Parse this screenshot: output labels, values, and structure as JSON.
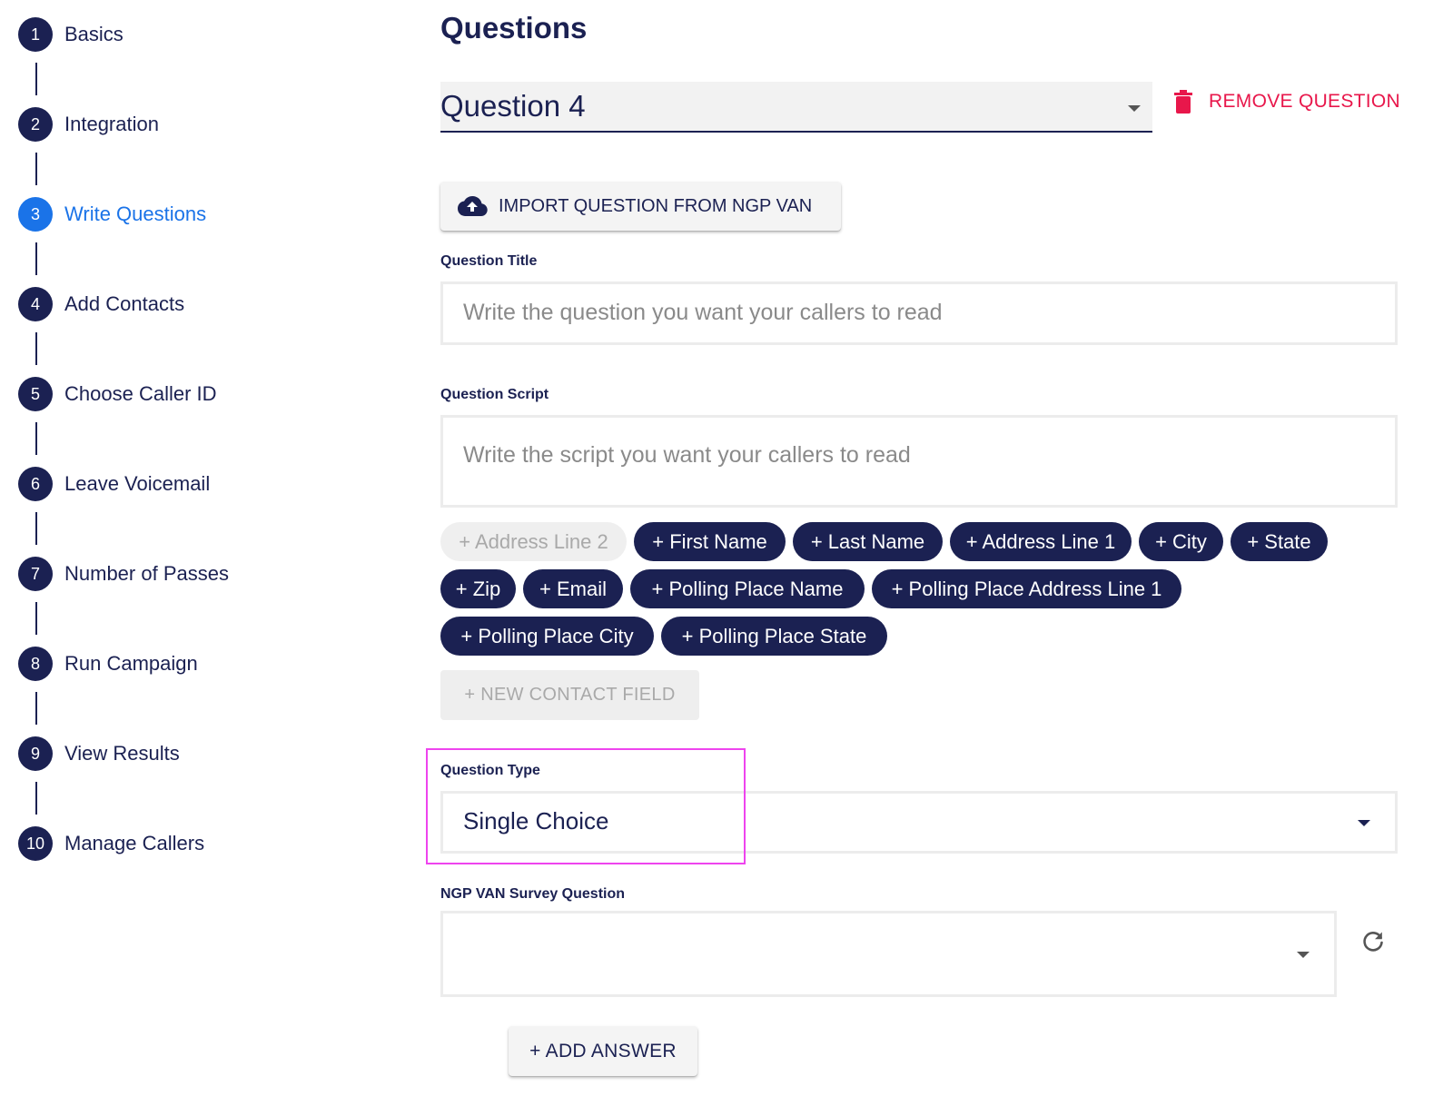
{
  "steps": [
    {
      "number": "1",
      "label": "Basics"
    },
    {
      "number": "2",
      "label": "Integration"
    },
    {
      "number": "3",
      "label": "Write Questions",
      "active": true
    },
    {
      "number": "4",
      "label": "Add Contacts"
    },
    {
      "number": "5",
      "label": "Choose Caller ID"
    },
    {
      "number": "6",
      "label": "Leave Voicemail"
    },
    {
      "number": "7",
      "label": "Number of Passes"
    },
    {
      "number": "8",
      "label": "Run Campaign"
    },
    {
      "number": "9",
      "label": "View Results"
    },
    {
      "number": "10",
      "label": "Manage Callers"
    }
  ],
  "main": {
    "title": "Questions",
    "question_select": {
      "value": "Question 4"
    },
    "remove_question_label": "REMOVE QUESTION",
    "import_button_label": "IMPORT QUESTION FROM NGP VAN",
    "question_title": {
      "label": "Question Title",
      "placeholder": "Write the question you want your callers to read",
      "value": ""
    },
    "question_script": {
      "label": "Question Script",
      "placeholder": "Write the script you want your callers to read",
      "value": ""
    },
    "contact_field_chips": [
      {
        "label": "+ Address Line 2",
        "disabled": true
      },
      {
        "label": "+ First Name"
      },
      {
        "label": "+ Last Name"
      },
      {
        "label": "+ Address Line 1"
      },
      {
        "label": "+ City"
      },
      {
        "label": "+ State"
      },
      {
        "label": "+ Zip"
      },
      {
        "label": "+ Email"
      },
      {
        "label": "+ Polling Place Name"
      },
      {
        "label": "+ Polling Place Address Line 1"
      },
      {
        "label": "+ Polling Place City"
      },
      {
        "label": "+ Polling Place State"
      }
    ],
    "new_contact_field_label": "+ NEW CONTACT FIELD",
    "question_type": {
      "label": "Question Type",
      "value": "Single Choice"
    },
    "ngp_van_survey_question": {
      "label": "NGP VAN Survey Question",
      "value": ""
    },
    "add_answer_label": "+ ADD ANSWER"
  },
  "colors": {
    "navy": "#1b2152",
    "active_blue": "#1a73e8",
    "danger": "#e8174b",
    "highlight": "#ee44ee",
    "chip_disabled_bg": "#efefef",
    "chip_disabled_text": "#a9a9a9"
  },
  "icons": {
    "remove": "trash-icon",
    "import": "cloud-upload-icon",
    "dropdown": "caret-down-icon",
    "refresh": "refresh-icon"
  }
}
